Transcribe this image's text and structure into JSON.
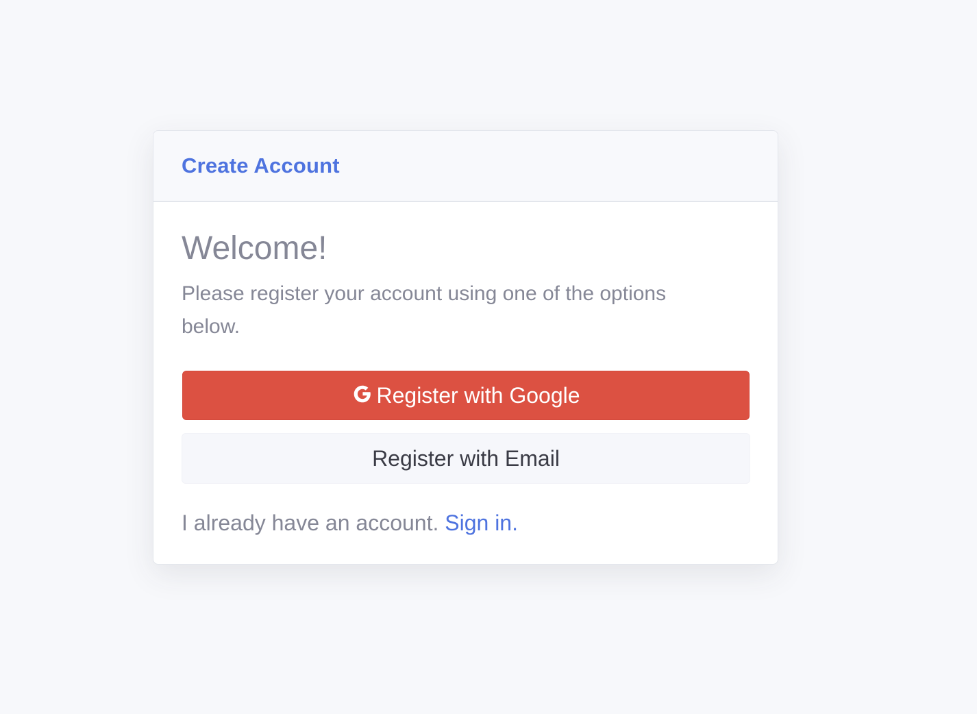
{
  "header": {
    "title": "Create Account"
  },
  "main": {
    "welcome_heading": "Welcome!",
    "intro_text": "Please register your account using one of the options below.",
    "google_button_label": "Register with Google",
    "email_button_label": "Register with Email",
    "signin_prompt": "I already have an account.",
    "signin_link_label": "Sign in."
  },
  "icons": {
    "google": "google-g-icon"
  },
  "colors": {
    "accent": "#4e73df",
    "google_button": "#dc5142",
    "email_button": "#f6f7fb",
    "muted_text": "#858796",
    "background": "#f7f8fb"
  }
}
